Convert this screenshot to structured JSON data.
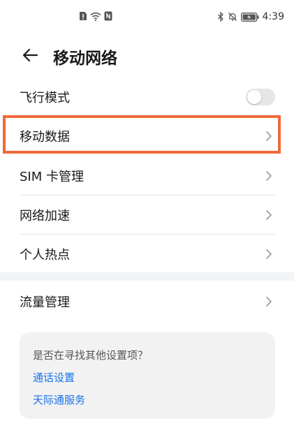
{
  "status_bar": {
    "time": "4:39",
    "left_icons": [
      "sim-alert-icon",
      "wifi-icon",
      "nfc-icon"
    ],
    "right_icons": [
      "bluetooth-icon",
      "silent-icon",
      "battery-icon"
    ]
  },
  "header": {
    "back_icon": "back-arrow-icon",
    "title": "移动网络"
  },
  "settings": {
    "airplane_mode": {
      "label": "飞行模式",
      "enabled": false
    },
    "mobile_data": {
      "label": "移动数据"
    },
    "sim_management": {
      "label": "SIM 卡管理"
    },
    "network_acceleration": {
      "label": "网络加速"
    },
    "hotspot": {
      "label": "个人热点"
    },
    "data_usage": {
      "label": "流量管理"
    }
  },
  "suggestion_card": {
    "question": "是否在寻找其他设置项？",
    "links": [
      "通话设置",
      "天际通服务"
    ]
  },
  "colors": {
    "highlight": "#f0693a",
    "link": "#1a73e8",
    "toggle_off": "#e6e6e6"
  }
}
